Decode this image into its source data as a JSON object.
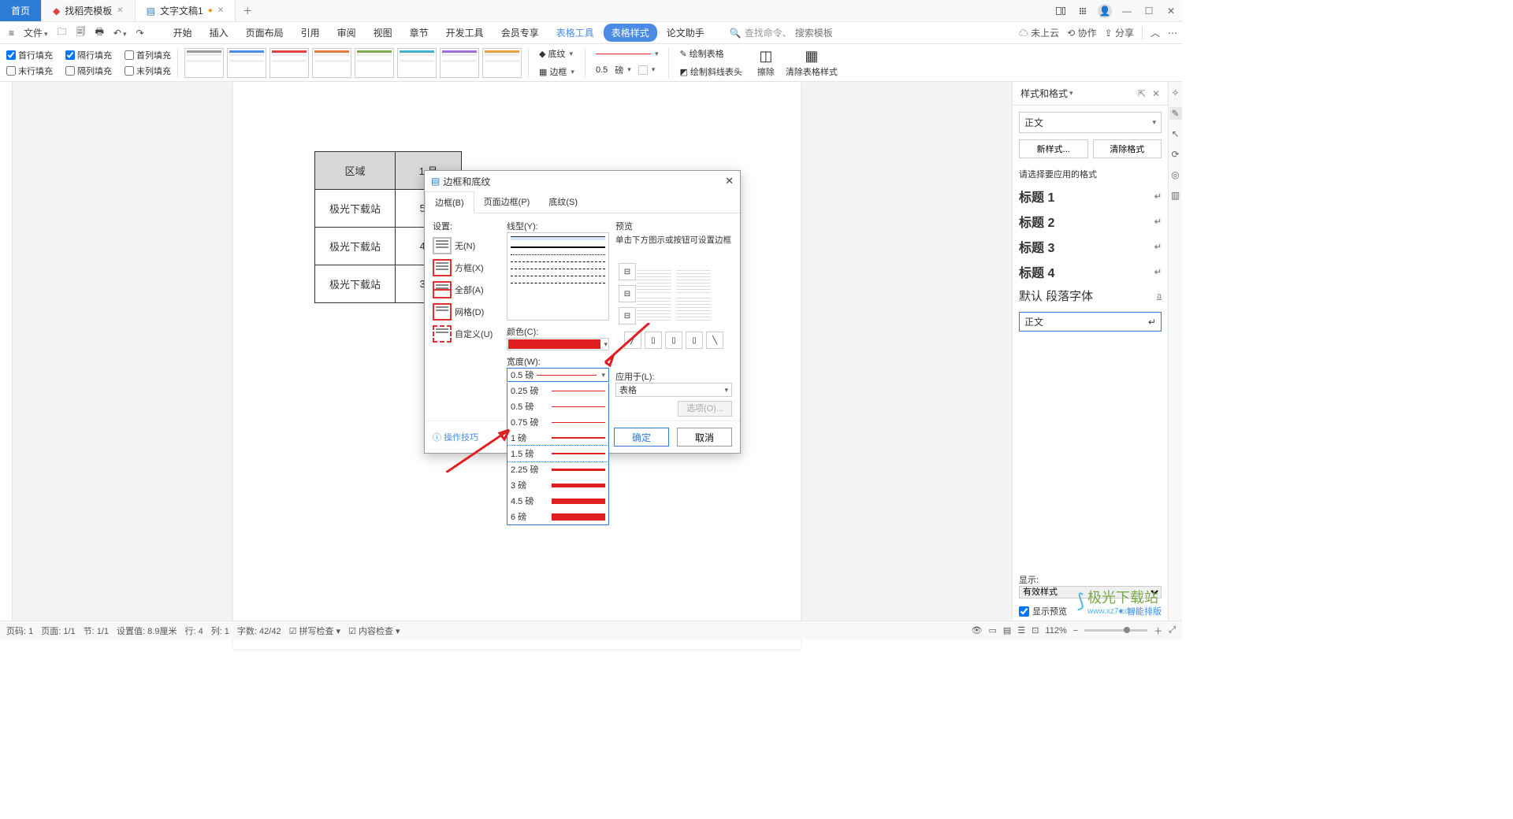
{
  "tabs": {
    "t0": "首页",
    "t1": "找稻壳模板",
    "t2": "文字文稿1"
  },
  "menu": [
    "开始",
    "插入",
    "页面布局",
    "引用",
    "审阅",
    "视图",
    "章节",
    "开发工具",
    "会员专享",
    "表格工具",
    "表格样式",
    "论文助手"
  ],
  "menu_blue_idx": [
    9
  ],
  "menu_selected_idx": 10,
  "file_label": "文件",
  "search": {
    "placeholder": "搜索模板",
    "hint": "查找命令、"
  },
  "header_right": {
    "cloud": "未上云",
    "coop": "协作",
    "share": "分享"
  },
  "ribbon": {
    "chks": {
      "c1": "首行填充",
      "c2": "隔行填充",
      "c3": "首列填充",
      "c4": "末行填充",
      "c5": "隔列填充",
      "c6": "末列填充"
    },
    "shading": "底纹",
    "border": "边框",
    "widthVal": "0.5",
    "widthUnit": "磅",
    "draw": "绘制表格",
    "drawdiag": "绘制斜线表头",
    "erase": "擦除",
    "clear": "清除表格样式"
  },
  "table": {
    "h1": "区域",
    "h2": "1 月",
    "rows": [
      [
        "极光下载站",
        "536"
      ],
      [
        "极光下载站",
        "474"
      ],
      [
        "极光下载站",
        "373"
      ]
    ]
  },
  "panel": {
    "title": "样式和格式",
    "current": "正文",
    "new": "新样式...",
    "clear": "清除格式",
    "prompt": "请选择要应用的格式",
    "styles": [
      "标题 1",
      "标题 2",
      "标题 3",
      "标题 4"
    ],
    "default_para": "默认 段落字体",
    "selected": "正文",
    "show": "显示:",
    "show_val": "有效样式",
    "preview": "显示预览",
    "smart": "智能排版"
  },
  "dialog": {
    "title": "边框和底纹",
    "tabs": [
      "边框(B)",
      "页面边框(P)",
      "底纹(S)"
    ],
    "setting": "设置:",
    "linetype": "线型(Y):",
    "color": "颜色(C):",
    "width": "宽度(W):",
    "preview": "预览",
    "preview_hint": "单击下方图示或按钮可设置边框",
    "apply": "应用于(L):",
    "apply_val": "表格",
    "options": "选项(O)...",
    "settings": [
      "无(N)",
      "方框(X)",
      "全部(A)",
      "网格(D)",
      "自定义(U)"
    ],
    "width_current": "0.5  磅",
    "width_opts": [
      "0.25 磅",
      "0.5  磅",
      "0.75 磅",
      "1    磅",
      "1.5  磅",
      "2.25 磅",
      "3    磅",
      "4.5  磅",
      "6    磅"
    ],
    "width_hl_idx": 4,
    "tip": "操作技巧",
    "ok": "确定",
    "cancel": "取消"
  },
  "status": {
    "page": "页码: 1",
    "pages": "页面: 1/1",
    "sec": "节: 1/1",
    "setval": "设置值: 8.9厘米",
    "row": "行: 4",
    "col": "列: 1",
    "chars": "字数: 42/42",
    "spell": "拼写检查",
    "content": "内容检查",
    "zoom": "112%"
  },
  "watermark": {
    "main": "极光下载站",
    "sub": "www.xz7.com"
  }
}
